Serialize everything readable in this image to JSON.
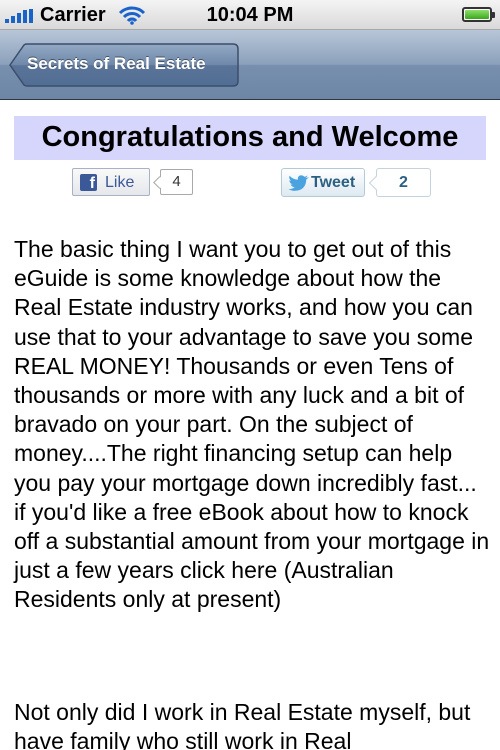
{
  "status_bar": {
    "carrier": "Carrier",
    "time": "10:04 PM",
    "battery_level": 1.0
  },
  "nav": {
    "back_label": "Secrets of Real Estate"
  },
  "content": {
    "title": "Congratulations and Welcome",
    "like_label": "Like",
    "like_count": "4",
    "tweet_label": "Tweet",
    "tweet_count": "2",
    "paragraphs": [
      "The basic thing I want you to get out of this eGuide is some knowledge about how the Real Estate industry works, and how you can use that to your advantage to save you some REAL MONEY! Thousands or even Tens of thousands or more with any luck and a bit of bravado on your part. On the subject of money....The right financing setup can help you pay your mortgage down incredibly fast... if you'd like a free eBook about how to knock off a substantial amount from your mortgage in just a few years click here (Australian Residents only at present)",
      "Not only did I work in Real Estate myself, but have family who still work in Real"
    ]
  },
  "colors": {
    "title_band": "#d6d5fb",
    "nav_bar": "#7890ae",
    "facebook_blue": "#3b5998",
    "twitter_text": "#2c6082"
  },
  "icons": [
    "signal-bars-icon",
    "wifi-icon",
    "battery-icon",
    "facebook-icon",
    "twitter-bird-icon"
  ]
}
